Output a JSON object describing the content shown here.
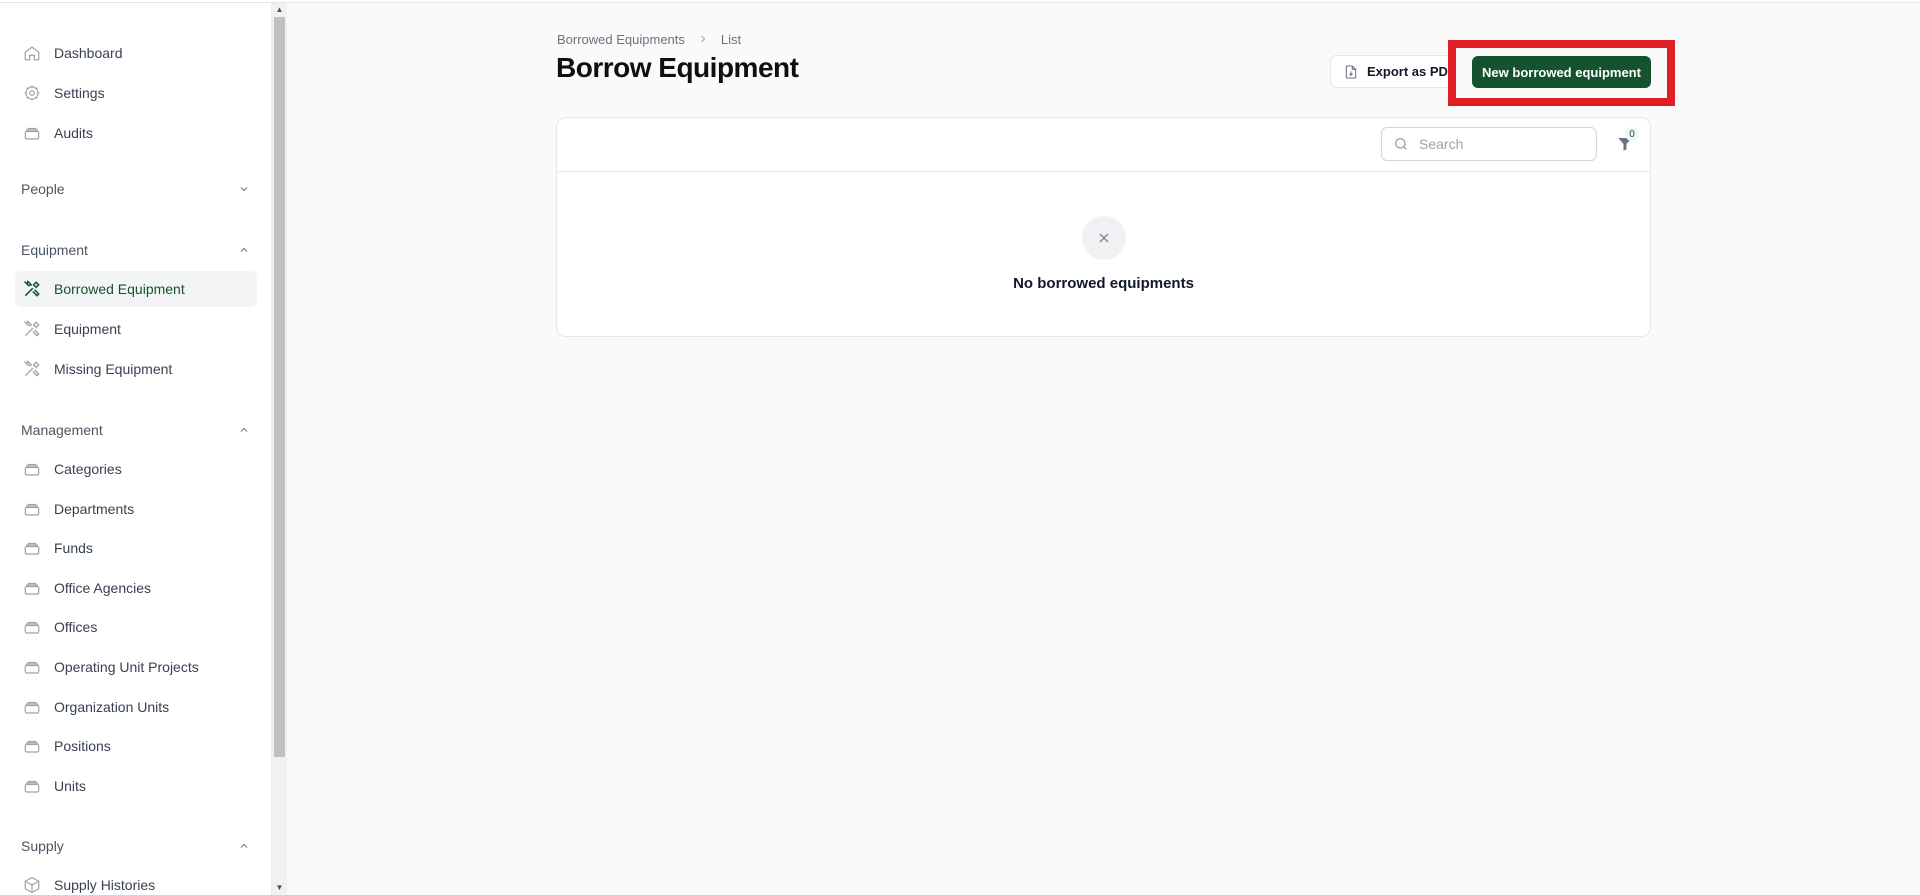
{
  "sidebar": {
    "top_items": [
      {
        "label": "Dashboard",
        "icon": "home-icon"
      },
      {
        "label": "Settings",
        "icon": "gear-icon"
      },
      {
        "label": "Audits",
        "icon": "stack-icon"
      }
    ],
    "groups": {
      "people": {
        "label": "People",
        "expanded": false
      },
      "equipment": {
        "label": "Equipment",
        "expanded": true,
        "items": [
          {
            "label": "Borrowed Equipment",
            "icon": "tools-icon",
            "active": true
          },
          {
            "label": "Equipment",
            "icon": "tools-icon"
          },
          {
            "label": "Missing Equipment",
            "icon": "tools-icon"
          }
        ]
      },
      "management": {
        "label": "Management",
        "expanded": true,
        "items": [
          {
            "label": "Categories",
            "icon": "stack-icon"
          },
          {
            "label": "Departments",
            "icon": "stack-icon"
          },
          {
            "label": "Funds",
            "icon": "stack-icon"
          },
          {
            "label": "Office Agencies",
            "icon": "stack-icon"
          },
          {
            "label": "Offices",
            "icon": "stack-icon"
          },
          {
            "label": "Operating Unit Projects",
            "icon": "stack-icon"
          },
          {
            "label": "Organization Units",
            "icon": "stack-icon"
          },
          {
            "label": "Positions",
            "icon": "stack-icon"
          },
          {
            "label": "Units",
            "icon": "stack-icon"
          }
        ]
      },
      "supply": {
        "label": "Supply",
        "expanded": true,
        "items": [
          {
            "label": "Supply Histories",
            "icon": "cube-icon"
          }
        ]
      }
    }
  },
  "breadcrumb": {
    "parent": "Borrowed Equipments",
    "current": "List"
  },
  "header": {
    "title": "Borrow Equipment",
    "export_label": "Export as PDF",
    "new_label": "New borrowed equipment"
  },
  "table": {
    "search_placeholder": "Search",
    "search_value": "",
    "filter_count": "0",
    "empty_message": "No borrowed equipments"
  },
  "colors": {
    "accent": "#14532d",
    "highlight": "#e01e28"
  }
}
